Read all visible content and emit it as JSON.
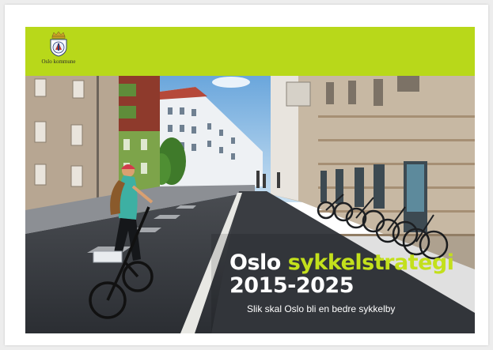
{
  "logo": {
    "text": "Oslo kommune"
  },
  "title": {
    "word_city": "Oslo",
    "word_strategy": "sykkelstrategi",
    "years": "2015-2025"
  },
  "subtitle": "Slik skal Oslo bli en bedre sykkelby",
  "colors": {
    "brand_green": "#b8d81a",
    "title_green": "#c3e01c",
    "title_white": "#ffffff"
  },
  "icons": [
    "oslo-coat-of-arms-icon"
  ]
}
